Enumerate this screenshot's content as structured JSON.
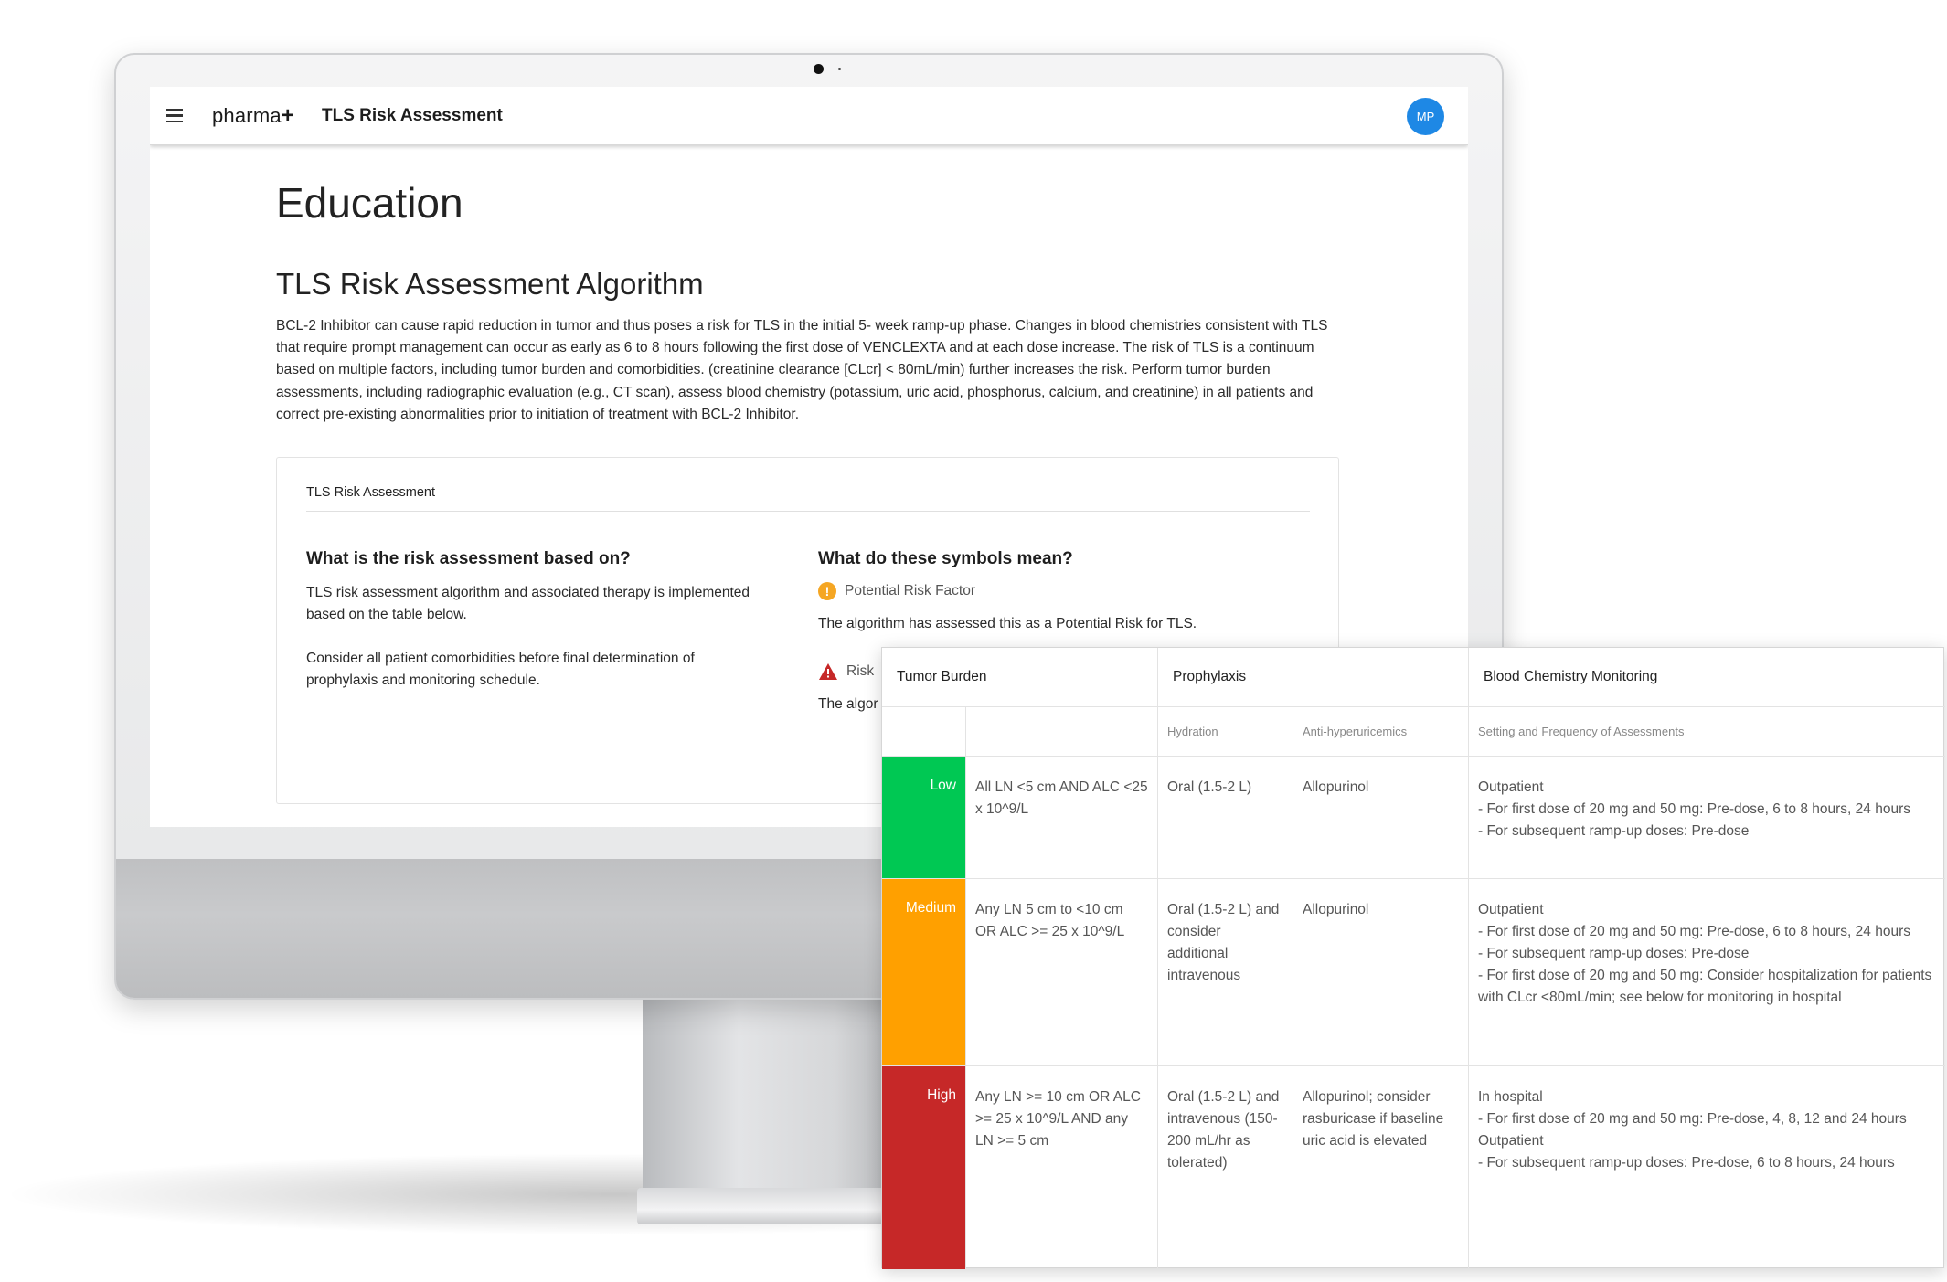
{
  "app": {
    "logo_text": "pharma",
    "logo_plus": "+",
    "title": "TLS Risk Assessment",
    "avatar_initials": "MP"
  },
  "page": {
    "title": "Education",
    "section_title": "TLS Risk Assessment Algorithm",
    "intro": "BCL-2 Inhibitor can cause rapid reduction in tumor and thus poses a risk for TLS in the initial 5- week ramp-up phase. Changes in blood chemistries consistent with TLS that require prompt management can occur as early as 6 to 8 hours following the first dose of VENCLEXTA and at each dose increase. The risk of TLS is a continuum based on multiple factors, including tumor burden and comorbidities. (creatinine clearance [CLcr] < 80mL/min) further increases the risk. Perform tumor burden assessments, including radiographic evaluation (e.g., CT scan), assess blood chemistry (potassium, uric acid, phosphorus, calcium, and creatinine) in all patients and correct pre-existing abnormalities prior to initiation of treatment with BCL-2 Inhibitor."
  },
  "card": {
    "header": "TLS Risk Assessment",
    "left_heading": "What is the risk assessment based on?",
    "left_p1": "TLS risk assessment algorithm and associated therapy is implemented based on the table below.",
    "left_p2": "Consider all patient comorbidities before final determination of prophylaxis and monitoring schedule.",
    "right_heading": "What do these symbols mean?",
    "potential_label": "Potential Risk Factor",
    "potential_desc": "The algorithm has assessed this as a Potential Risk for TLS.",
    "risk_label": "Risk",
    "risk_desc": "The algor"
  },
  "table": {
    "headers": {
      "tumor_burden": "Tumor Burden",
      "prophylaxis": "Prophylaxis",
      "monitoring": "Blood Chemistry Monitoring"
    },
    "subheaders": {
      "hydration": "Hydration",
      "anti": "Anti-hyperuricemics",
      "setting": "Setting and Frequency of Assessments"
    },
    "rows": [
      {
        "level": "Low",
        "color": "#00c853",
        "burden": "All LN <5 cm AND ALC <25 x 10^9/L",
        "hydration": "Oral (1.5-2 L)",
        "anti": "Allopurinol",
        "monitoring": "Outpatient\n- For first dose of 20 mg and 50 mg: Pre-dose, 6 to 8 hours, 24 hours\n- For subsequent ramp-up doses: Pre-dose"
      },
      {
        "level": "Medium",
        "color": "#ffa000",
        "burden": "Any LN 5 cm to <10 cm OR ALC >= 25 x 10^9/L",
        "hydration": "Oral (1.5-2 L) and consider additional intravenous",
        "anti": "Allopurinol",
        "monitoring": "Outpatient\n- For first dose of 20 mg and 50 mg: Pre-dose, 6 to 8 hours, 24 hours\n- For subsequent ramp-up doses: Pre-dose\n- For first dose of 20 mg and 50 mg: Consider hospitalization for patients with CLcr <80mL/min; see below for monitoring in hospital"
      },
      {
        "level": "High",
        "color": "#c62828",
        "burden": "Any LN >= 10 cm OR ALC >= 25 x 10^9/L AND any LN >= 5 cm",
        "hydration": "Oral (1.5-2 L) and intravenous (150-200 mL/hr as tolerated)",
        "anti": "Allopurinol; consider rasburicase if baseline uric acid is elevated",
        "monitoring": "In hospital\n- For first dose of 20 mg and 50 mg: Pre-dose, 4, 8, 12 and 24 hours\nOutpatient\n- For subsequent ramp-up doses: Pre-dose, 6 to 8 hours, 24 hours"
      }
    ]
  }
}
